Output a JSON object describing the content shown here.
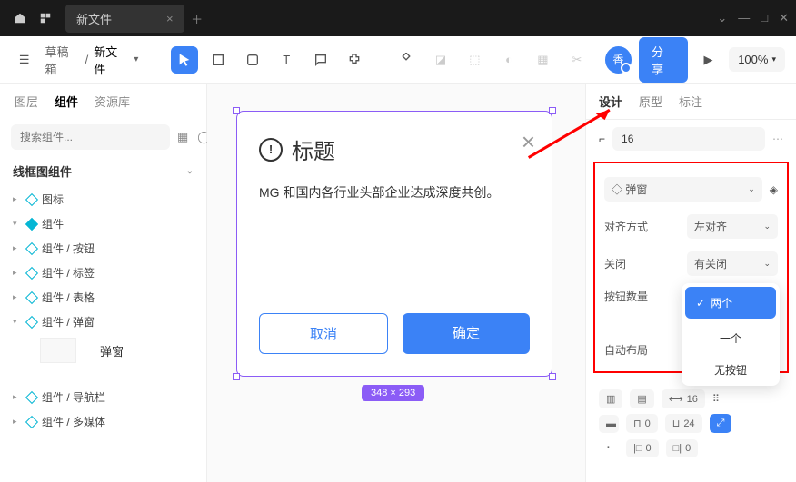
{
  "titlebar": {
    "tab_title": "新文件"
  },
  "breadcrumb": {
    "folder": "草稿箱",
    "file": "新文件"
  },
  "toolbar": {
    "avatar": "香",
    "share": "分享",
    "zoom": "100%"
  },
  "left": {
    "tabs": [
      "图层",
      "组件",
      "资源库"
    ],
    "search_ph": "搜索组件...",
    "section": "线框图组件",
    "items": [
      "图标",
      "组件",
      "组件 / 按钮",
      "组件 / 标签",
      "组件 / 表格",
      "组件 / 弹窗"
    ],
    "thumb_label": "弹窗",
    "extra": [
      "组件 / 导航栏",
      "组件 / 多媒体"
    ]
  },
  "canvas": {
    "dialog_title": "标题",
    "dialog_body": "MG 和国内各行业头部企业达成深度共创。",
    "btn_cancel": "取消",
    "btn_ok": "确定",
    "dim": "348 × 293"
  },
  "right": {
    "tabs": [
      "设计",
      "原型",
      "标注"
    ],
    "radius": "16",
    "component": "弹窗",
    "props": {
      "align_l": "对齐方式",
      "align_v": "左对齐",
      "close_l": "关闭",
      "close_v": "有关闭",
      "btns_l": "按钮数量",
      "auto_l": "自动布局"
    },
    "dropdown": [
      "两个",
      "一个",
      "无按钮"
    ],
    "spacing": {
      "a": "16",
      "b": "0",
      "c": "24",
      "d": "0",
      "e": "0"
    }
  }
}
